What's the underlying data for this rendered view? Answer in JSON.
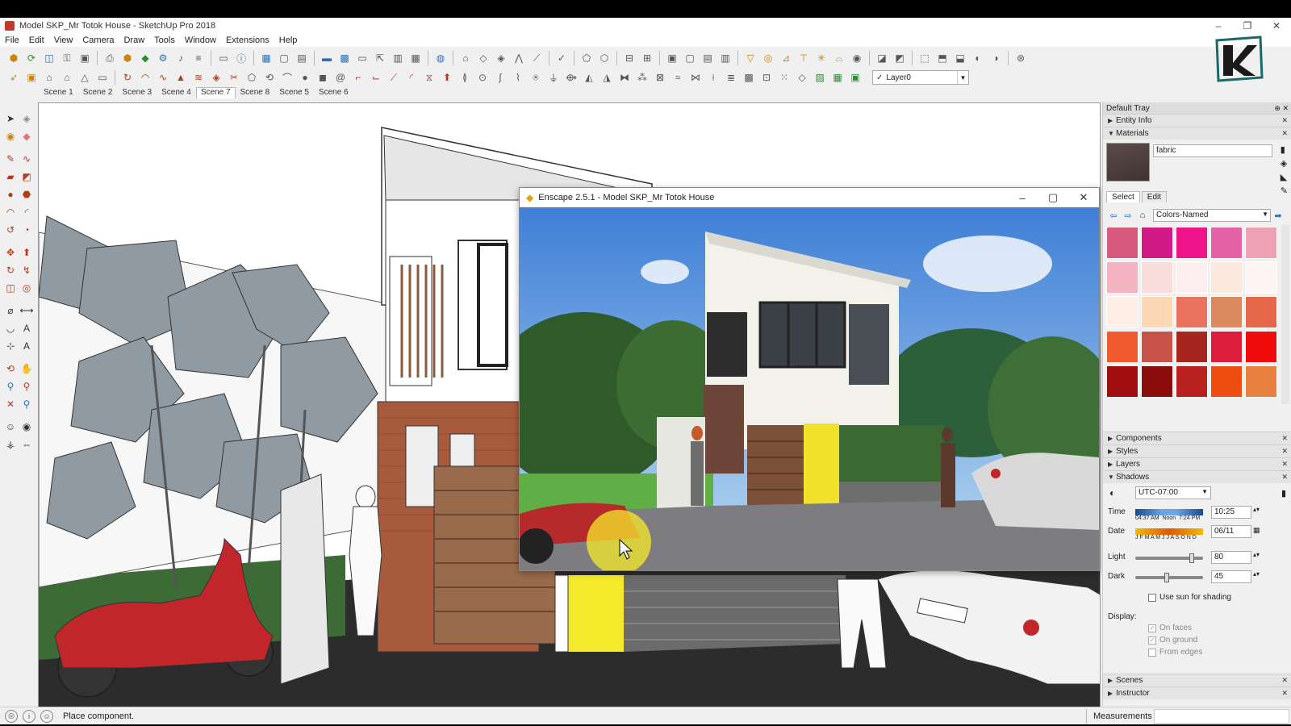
{
  "window": {
    "title": "Model SKP_Mr Totok House - SketchUp Pro 2018",
    "minimize": "–",
    "maximize": "❐",
    "close": "✕"
  },
  "menu": [
    "File",
    "Edit",
    "View",
    "Camera",
    "Draw",
    "Tools",
    "Window",
    "Extensions",
    "Help"
  ],
  "layer": {
    "current": "Layer0"
  },
  "scenes": [
    "Scene 1",
    "Scene 2",
    "Scene 3",
    "Scene 4",
    "Scene 7",
    "Scene 8",
    "Scene 5",
    "Scene 6"
  ],
  "active_scene": "Scene 7",
  "enscape": {
    "title": "Enscape 2.5.1 - Model SKP_Mr Totok House"
  },
  "tray": {
    "title": "Default Tray",
    "panels": {
      "entity_info": "Entity Info",
      "materials": "Materials",
      "components": "Components",
      "styles": "Styles",
      "layers": "Layers",
      "shadows": "Shadows",
      "scenes": "Scenes",
      "instructor": "Instructor"
    },
    "materials": {
      "name": "fabric",
      "tab_select": "Select",
      "tab_edit": "Edit",
      "library": "Colors-Named",
      "swatches": [
        "#d85a7f",
        "#d11a86",
        "#f0148a",
        "#e561a8",
        "#eea0b5",
        "#f4b3c0",
        "#f9dcdc",
        "#fdeef0",
        "#fbe9dd",
        "#fdf5f3",
        "#fdeee6",
        "#fcd8b6",
        "#e8715f",
        "#d98a5e",
        "#e6684b",
        "#ef5a2e",
        "#c75248",
        "#a6261f",
        "#dd1d3c",
        "#f00c0c",
        "#a10e10",
        "#8a0c0c",
        "#b82020",
        "#ee4e12",
        "#e88040"
      ]
    },
    "shadows": {
      "timezone": "UTC-07:00",
      "time_label": "Time",
      "time_marks": "04:37 AM  Noon  7:24 PM",
      "time_value": "10:25",
      "date_label": "Date",
      "date_marks": "J F M A M J J A S O N D",
      "date_value": "06/11",
      "light_label": "Light",
      "light_value": "80",
      "dark_label": "Dark",
      "dark_value": "45",
      "use_sun": "Use sun for shading",
      "display_label": "Display:",
      "on_faces": "On faces",
      "on_ground": "On ground",
      "from_edges": "From edges"
    }
  },
  "status": {
    "text": "Place component.",
    "measurements_label": "Measurements"
  },
  "colors": {
    "enscape_icon": "#e8a10e",
    "highlight": "#f5e92b"
  }
}
